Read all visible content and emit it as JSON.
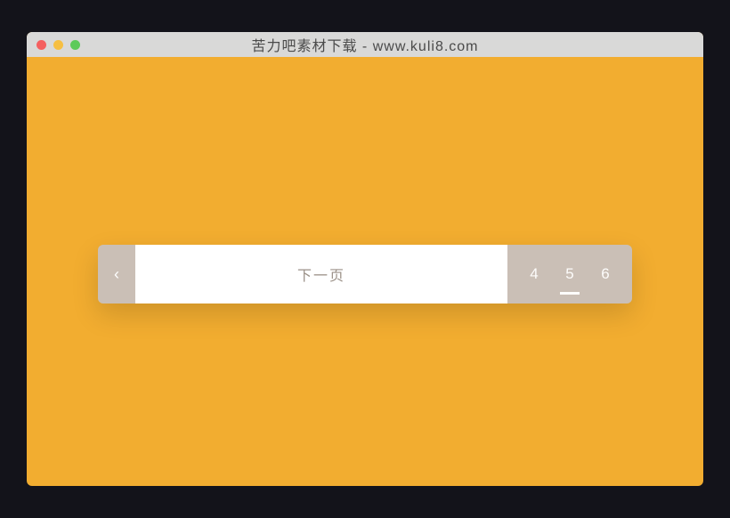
{
  "window": {
    "title": "苦力吧素材下载 - www.kuli8.com"
  },
  "pagination": {
    "prev_icon": "‹",
    "next_label": "下一页",
    "pages": [
      {
        "label": "4",
        "active": false
      },
      {
        "label": "5",
        "active": true
      },
      {
        "label": "6",
        "active": false
      }
    ]
  }
}
